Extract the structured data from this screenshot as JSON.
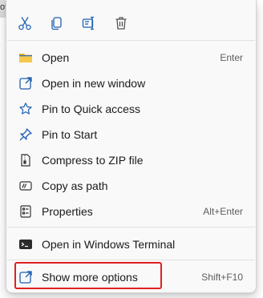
{
  "background": {
    "left_fragment": "ot"
  },
  "toolbar": [
    {
      "name": "cut",
      "icon": "scissors-icon"
    },
    {
      "name": "copy",
      "icon": "copy-icon"
    },
    {
      "name": "rename",
      "icon": "rename-icon"
    },
    {
      "name": "delete",
      "icon": "trash-icon"
    }
  ],
  "menu": {
    "items": [
      {
        "label": "Open",
        "shortcut": "Enter",
        "icon": "folder-icon"
      },
      {
        "label": "Open in new window",
        "shortcut": "",
        "icon": "open-new-window-icon"
      },
      {
        "label": "Pin to Quick access",
        "shortcut": "",
        "icon": "star-icon"
      },
      {
        "label": "Pin to Start",
        "shortcut": "",
        "icon": "pin-icon"
      },
      {
        "label": "Compress to ZIP file",
        "shortcut": "",
        "icon": "zip-icon"
      },
      {
        "label": "Copy as path",
        "shortcut": "",
        "icon": "path-icon"
      },
      {
        "label": "Properties",
        "shortcut": "Alt+Enter",
        "icon": "properties-icon"
      },
      {
        "label": "Open in Windows Terminal",
        "shortcut": "",
        "icon": "terminal-icon"
      },
      {
        "label": "Show more options",
        "shortcut": "Shift+F10",
        "icon": "more-options-icon"
      }
    ]
  },
  "colors": {
    "accent": "#2b6fc7",
    "highlight_box": "#e02020",
    "folder": "#f4c542"
  }
}
